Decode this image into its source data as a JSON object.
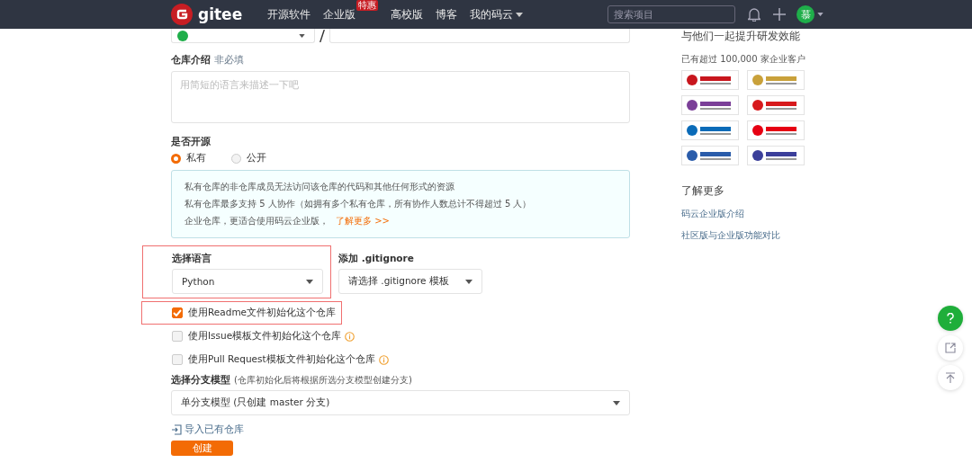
{
  "header": {
    "brand": "gitee",
    "nav": [
      {
        "label": "开源软件",
        "caret": false
      },
      {
        "label": "企业版",
        "badge": "特惠",
        "caret": false
      },
      {
        "label": "高校版",
        "caret": false
      },
      {
        "label": "博客",
        "caret": false
      },
      {
        "label": "我的码云",
        "caret": true
      }
    ],
    "search": {
      "placeholder": "搜索项目"
    },
    "avatar": "慕"
  },
  "form": {
    "description": {
      "label": "仓库介绍",
      "hint": "非必填",
      "placeholder": "用简短的语言来描述一下吧"
    },
    "visibility": {
      "label": "是否开源",
      "options": [
        {
          "label": "私有",
          "selected": true
        },
        {
          "label": "公开",
          "selected": false
        }
      ]
    },
    "notice": {
      "lines": [
        "私有仓库的非仓库成员无法访问该仓库的代码和其他任何形式的资源",
        "私有仓库最多支持 5 人协作（如拥有多个私有仓库，所有协作人数总计不得超过 5 人）",
        "企业仓库，更适合使用码云企业版，"
      ],
      "link": "了解更多 >>"
    },
    "language": {
      "label": "选择语言",
      "value": "Python",
      "highlighted": true
    },
    "gitignore": {
      "label": "添加 .gitignore",
      "value": "请选择 .gitignore 模板"
    },
    "options": [
      {
        "label": "使用Readme文件初始化这个仓库",
        "checked": true,
        "info": false,
        "highlighted": true
      },
      {
        "label": "使用Issue模板文件初始化这个仓库",
        "checked": false,
        "info": true,
        "highlighted": false
      },
      {
        "label": "使用Pull Request模板文件初始化这个仓库",
        "checked": false,
        "info": true,
        "highlighted": false
      }
    ],
    "branch": {
      "label": "选择分支模型",
      "hint": "(仓库初始化后将根据所选分支模型创建分支)",
      "value": "单分支模型 (只创建 master 分支)"
    },
    "import_link": "导入已有仓库",
    "submit": "创建"
  },
  "sidebar": {
    "title": "与他们一起提升研发效能",
    "subtitle": "已有超过 100,000 家企业客户",
    "logos": [
      {
        "color": "#c8161d"
      },
      {
        "color": "#c9a13a"
      },
      {
        "color": "#7b3f98"
      },
      {
        "color": "#d7191c"
      },
      {
        "color": "#0a6bb8"
      },
      {
        "color": "#e60012"
      },
      {
        "color": "#2a5caa"
      },
      {
        "color": "#3b3f9a"
      }
    ],
    "more_title": "了解更多",
    "links": [
      "码云企业版介绍",
      "社区版与企业版功能对比"
    ]
  }
}
